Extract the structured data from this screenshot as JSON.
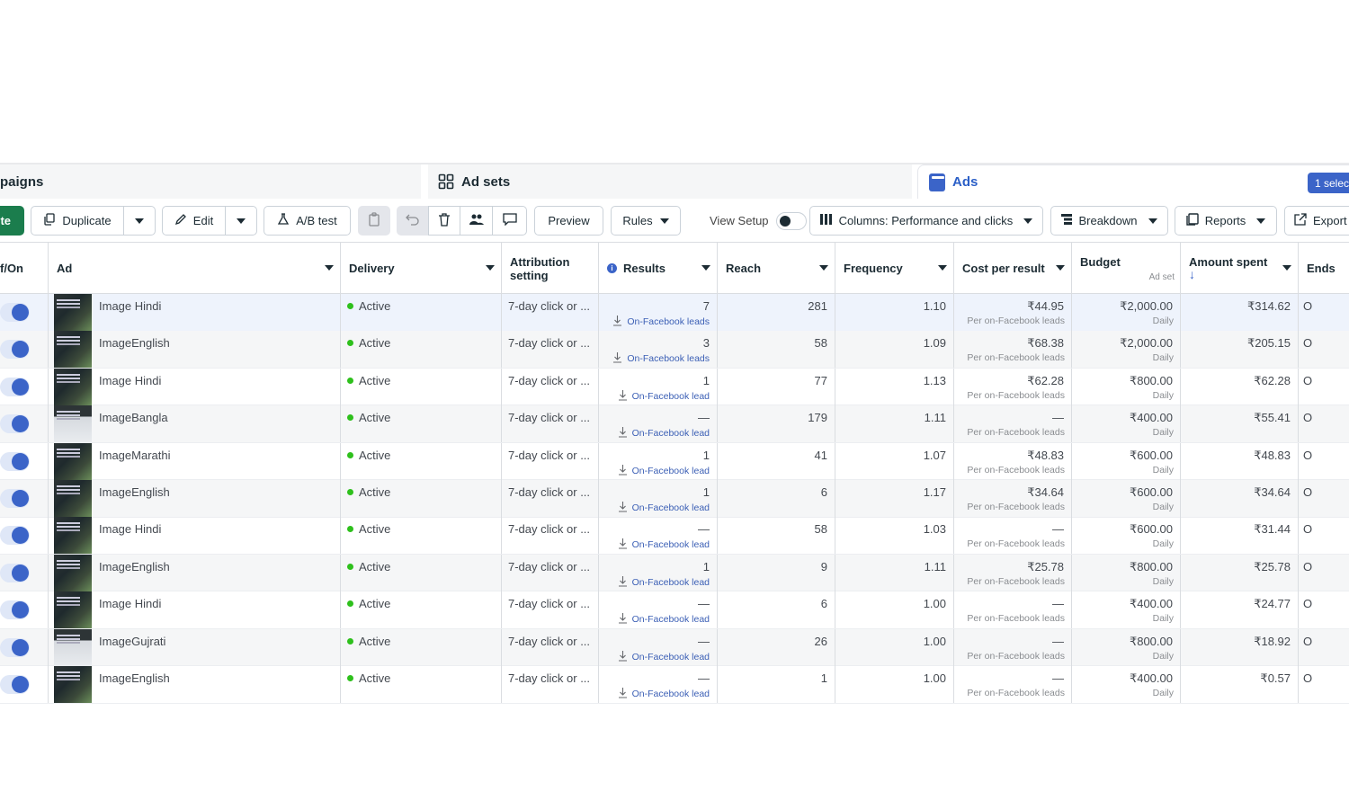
{
  "tabs": {
    "campaigns": "paigns",
    "adsets": "Ad sets",
    "ads": "Ads",
    "selected": "1 selec"
  },
  "toolbar": {
    "create": "te",
    "duplicate": "Duplicate",
    "edit": "Edit",
    "ab_test": "A/B test",
    "preview": "Preview",
    "rules": "Rules",
    "view_setup": "View Setup",
    "columns": "Columns: Performance and clicks",
    "breakdown": "Breakdown",
    "reports": "Reports",
    "export": "Export"
  },
  "headers": {
    "toggle": "f/On",
    "ad": "Ad",
    "delivery": "Delivery",
    "attribution": "Attribution setting",
    "results": "Results",
    "reach": "Reach",
    "frequency": "Frequency",
    "cost_per_result": "Cost per result",
    "budget": "Budget",
    "budget_sub": "Ad set",
    "amount_spent": "Amount spent",
    "ends": "Ends"
  },
  "rows": [
    {
      "ad": "Image Hindi",
      "delivery": "Active",
      "attribution": "7-day click or ...",
      "results": "7",
      "results_note": "On-Facebook leads",
      "reach": "281",
      "frequency": "1.10",
      "cpr": "₹44.95",
      "cpr_note": "Per on-Facebook leads",
      "budget": "₹2,000.00",
      "budget_note": "Daily",
      "spent": "₹314.62",
      "ends": "O"
    },
    {
      "ad": "ImageEnglish",
      "delivery": "Active",
      "attribution": "7-day click or ...",
      "results": "3",
      "results_note": "On-Facebook leads",
      "reach": "58",
      "frequency": "1.09",
      "cpr": "₹68.38",
      "cpr_note": "Per on-Facebook leads",
      "budget": "₹2,000.00",
      "budget_note": "Daily",
      "spent": "₹205.15",
      "ends": "O"
    },
    {
      "ad": "Image Hindi",
      "delivery": "Active",
      "attribution": "7-day click or ...",
      "results": "1",
      "results_note": "On-Facebook lead",
      "reach": "77",
      "frequency": "1.13",
      "cpr": "₹62.28",
      "cpr_note": "Per on-Facebook leads",
      "budget": "₹800.00",
      "budget_note": "Daily",
      "spent": "₹62.28",
      "ends": "O"
    },
    {
      "ad": "ImageBangla",
      "delivery": "Active",
      "attribution": "7-day click or ...",
      "results": "—",
      "results_note": "On-Facebook lead",
      "reach": "179",
      "frequency": "1.11",
      "cpr": "—",
      "cpr_note": "Per on-Facebook leads",
      "budget": "₹400.00",
      "budget_note": "Daily",
      "spent": "₹55.41",
      "ends": "O"
    },
    {
      "ad": "ImageMarathi",
      "delivery": "Active",
      "attribution": "7-day click or ...",
      "results": "1",
      "results_note": "On-Facebook lead",
      "reach": "41",
      "frequency": "1.07",
      "cpr": "₹48.83",
      "cpr_note": "Per on-Facebook leads",
      "budget": "₹600.00",
      "budget_note": "Daily",
      "spent": "₹48.83",
      "ends": "O"
    },
    {
      "ad": "ImageEnglish",
      "delivery": "Active",
      "attribution": "7-day click or ...",
      "results": "1",
      "results_note": "On-Facebook lead",
      "reach": "6",
      "frequency": "1.17",
      "cpr": "₹34.64",
      "cpr_note": "Per on-Facebook leads",
      "budget": "₹600.00",
      "budget_note": "Daily",
      "spent": "₹34.64",
      "ends": "O"
    },
    {
      "ad": "Image Hindi",
      "delivery": "Active",
      "attribution": "7-day click or ...",
      "results": "—",
      "results_note": "On-Facebook lead",
      "reach": "58",
      "frequency": "1.03",
      "cpr": "—",
      "cpr_note": "Per on-Facebook leads",
      "budget": "₹600.00",
      "budget_note": "Daily",
      "spent": "₹31.44",
      "ends": "O"
    },
    {
      "ad": "ImageEnglish",
      "delivery": "Active",
      "attribution": "7-day click or ...",
      "results": "1",
      "results_note": "On-Facebook lead",
      "reach": "9",
      "frequency": "1.11",
      "cpr": "₹25.78",
      "cpr_note": "Per on-Facebook leads",
      "budget": "₹800.00",
      "budget_note": "Daily",
      "spent": "₹25.78",
      "ends": "O"
    },
    {
      "ad": "Image Hindi",
      "delivery": "Active",
      "attribution": "7-day click or ...",
      "results": "—",
      "results_note": "On-Facebook lead",
      "reach": "6",
      "frequency": "1.00",
      "cpr": "—",
      "cpr_note": "Per on-Facebook leads",
      "budget": "₹400.00",
      "budget_note": "Daily",
      "spent": "₹24.77",
      "ends": "O"
    },
    {
      "ad": "ImageGujrati",
      "delivery": "Active",
      "attribution": "7-day click or ...",
      "results": "—",
      "results_note": "On-Facebook lead",
      "reach": "26",
      "frequency": "1.00",
      "cpr": "—",
      "cpr_note": "Per on-Facebook leads",
      "budget": "₹800.00",
      "budget_note": "Daily",
      "spent": "₹18.92",
      "ends": "O"
    },
    {
      "ad": "ImageEnglish",
      "delivery": "Active",
      "attribution": "7-day click or ...",
      "results": "—",
      "results_note": "On-Facebook lead",
      "reach": "1",
      "frequency": "1.00",
      "cpr": "—",
      "cpr_note": "Per on-Facebook leads",
      "budget": "₹400.00",
      "budget_note": "Daily",
      "spent": "₹0.57",
      "ends": "O"
    }
  ],
  "colors": {
    "accent": "#3b64c8",
    "create": "#1b7d4d",
    "active_dot": "#2ec01c",
    "lead_link": "#3b5fb5"
  }
}
